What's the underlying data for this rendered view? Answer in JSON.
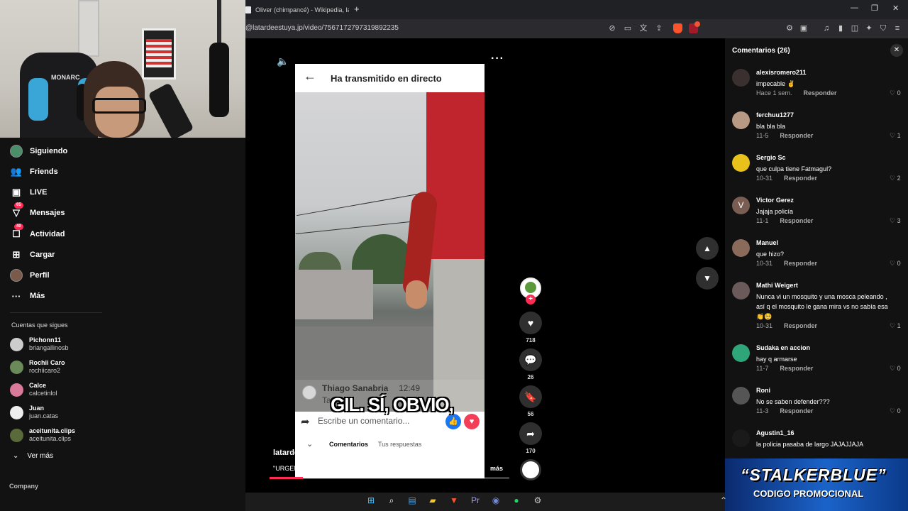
{
  "browser": {
    "tab_title": "Oliver (chimpancé) - Wikipedia, la en",
    "new_tab": "+",
    "url": "@latardeestuya.jp/video/7567172797319892235",
    "window_controls": [
      "—",
      "❐",
      "✕"
    ]
  },
  "sidebar": {
    "items": [
      {
        "label": "Siguiendo",
        "icon": "avatar-icon"
      },
      {
        "label": "Friends",
        "icon": "friends-icon"
      },
      {
        "label": "LIVE",
        "icon": "live-icon"
      },
      {
        "label": "Mensajes",
        "icon": "messages-icon",
        "badge": "65"
      },
      {
        "label": "Actividad",
        "icon": "activity-icon",
        "badge": "40"
      },
      {
        "label": "Cargar",
        "icon": "upload-icon"
      },
      {
        "label": "Perfil",
        "icon": "profile-icon"
      },
      {
        "label": "Más",
        "icon": "more-icon"
      }
    ],
    "following_header": "Cuentas que sigues",
    "following": [
      {
        "name": "Pichonn11",
        "user": "briangallinosb"
      },
      {
        "name": "Rochii Caro",
        "user": "rochiicaro2"
      },
      {
        "name": "Calce",
        "user": "calcetinlol"
      },
      {
        "name": "Juan",
        "user": "juan.catas"
      },
      {
        "name": "aceitunita.clips",
        "user": "aceitunita.clips"
      }
    ],
    "see_more": "Ver más",
    "company": "Company"
  },
  "video": {
    "phone_header": "Ha transmitido en directo",
    "comment_name": "Thiago Sanabria",
    "comment_time": "12:49",
    "comment_partial": "Tan",
    "caption": "GIL. SÍ, OBVIO,",
    "comment_placeholder": "Escribe un comentario...",
    "phone_tabs": [
      "Comentarios",
      "Tus respuestas"
    ],
    "author": "latardeestuya.jp",
    "description": "\"URGENTE: Florida en la mira! Estas cosas pasan en Florida a toda",
    "more": "más",
    "progress_percent": 14,
    "likes": "718",
    "comments": "26",
    "saves": "56",
    "shares": "170"
  },
  "comments_panel": {
    "title": "Comentarios (26)",
    "reply_label": "Responder",
    "items": [
      {
        "user": "alexisromero211",
        "text": "impecable ✌",
        "date": "Hace 1 sem.",
        "likes": "0",
        "color": "#3a3030"
      },
      {
        "user": "ferchuu1277",
        "text": "bla bla bla",
        "date": "11-5",
        "likes": "1",
        "color": "#b89a84"
      },
      {
        "user": "Sergio Sc",
        "text": "que culpa tiene Fatmagul?",
        "date": "10-31",
        "likes": "2",
        "color": "#e8c21a"
      },
      {
        "user": "Victor Gerez",
        "text": "Jajaja policía",
        "date": "11-1",
        "likes": "3",
        "color": "#7a5d52",
        "initial": "V"
      },
      {
        "user": "Manuel",
        "text": "que hizo?",
        "date": "10-31",
        "likes": "0",
        "color": "#8a6a5a"
      },
      {
        "user": "Mathi Weigert",
        "text": "Nunca vi un mosquito y una mosca peleando , así q el mosquito le gana mira vs no sabía esa 👏🥺",
        "date": "10-31",
        "likes": "1",
        "color": "#6a5a5a"
      },
      {
        "user": "Sudaka en accion",
        "text": "hay q armarse",
        "date": "11-7",
        "likes": "0",
        "color": "#2fa57a"
      },
      {
        "user": "Roni",
        "text": "No se saben defender???",
        "date": "11-3",
        "likes": "0",
        "color": "#555"
      },
      {
        "user": "Agustin1_16",
        "text": "la policia pasaba de largo JAJAJJAJA",
        "date": "",
        "likes": "",
        "color": "#1a1a1a"
      }
    ]
  },
  "promo": {
    "line1": "“STALKERBLUE”",
    "line2": "CODIGO PROMOCIONAL"
  },
  "colors": {
    "accent": "#fe2c55",
    "background": "#121212"
  }
}
